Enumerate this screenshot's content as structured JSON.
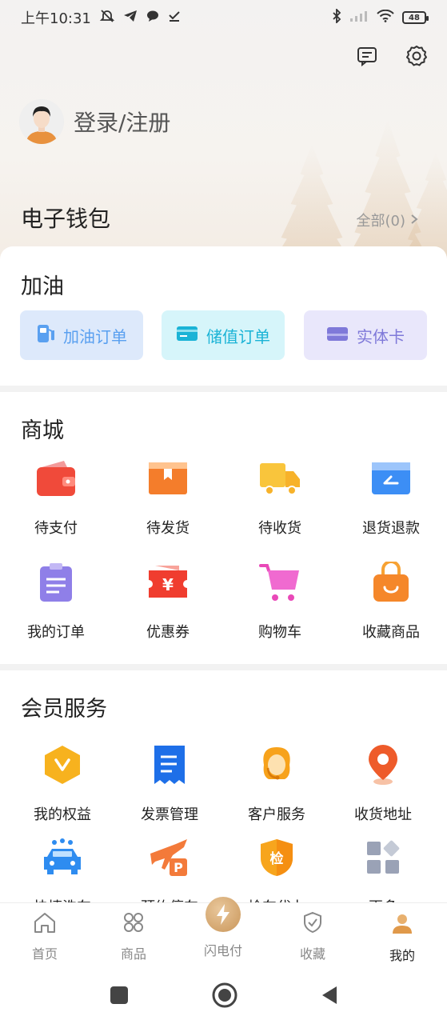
{
  "status_bar": {
    "time": "上午10:31",
    "battery": "48"
  },
  "profile": {
    "login_label": "登录/注册"
  },
  "wallet": {
    "title": "电子钱包",
    "all_label": "全部(0)"
  },
  "fuel": {
    "title": "加油",
    "buttons": [
      {
        "label": "加油订单",
        "icon": "fuel-pump-icon",
        "color": "#5aa0f0"
      },
      {
        "label": "储值订单",
        "icon": "stored-value-card-icon",
        "color": "#1ab3d6"
      },
      {
        "label": "实体卡",
        "icon": "physical-card-icon",
        "color": "#7f79d9"
      }
    ]
  },
  "mall": {
    "title": "商城",
    "items": [
      {
        "label": "待支付",
        "icon": "wallet-icon"
      },
      {
        "label": "待发货",
        "icon": "package-icon"
      },
      {
        "label": "待收货",
        "icon": "truck-icon"
      },
      {
        "label": "退货退款",
        "icon": "return-icon"
      },
      {
        "label": "我的订单",
        "icon": "clipboard-icon"
      },
      {
        "label": "优惠券",
        "icon": "coupon-icon"
      },
      {
        "label": "购物车",
        "icon": "cart-icon"
      },
      {
        "label": "收藏商品",
        "icon": "bag-icon"
      }
    ]
  },
  "member": {
    "title": "会员服务",
    "items": [
      {
        "label": "我的权益",
        "icon": "benefits-icon"
      },
      {
        "label": "发票管理",
        "icon": "invoice-icon"
      },
      {
        "label": "客户服务",
        "icon": "customer-service-icon"
      },
      {
        "label": "收货地址",
        "icon": "location-pin-icon"
      },
      {
        "label": "快捷洗车",
        "icon": "car-wash-icon"
      },
      {
        "label": "预约停车",
        "icon": "parking-icon"
      },
      {
        "label": "检车代办",
        "icon": "inspection-icon"
      },
      {
        "label": "更多",
        "icon": "more-grid-icon"
      }
    ]
  },
  "tabs": [
    {
      "label": "首页",
      "icon": "home-icon"
    },
    {
      "label": "商品",
      "icon": "products-icon"
    },
    {
      "label": "闪电付",
      "icon": "lightning-icon"
    },
    {
      "label": "收藏",
      "icon": "favorites-icon"
    },
    {
      "label": "我的",
      "icon": "profile-icon"
    }
  ],
  "colors": {
    "accent": "#f5a623",
    "brand_gold": "#c9965a",
    "text": "#222222",
    "muted": "#999999"
  }
}
